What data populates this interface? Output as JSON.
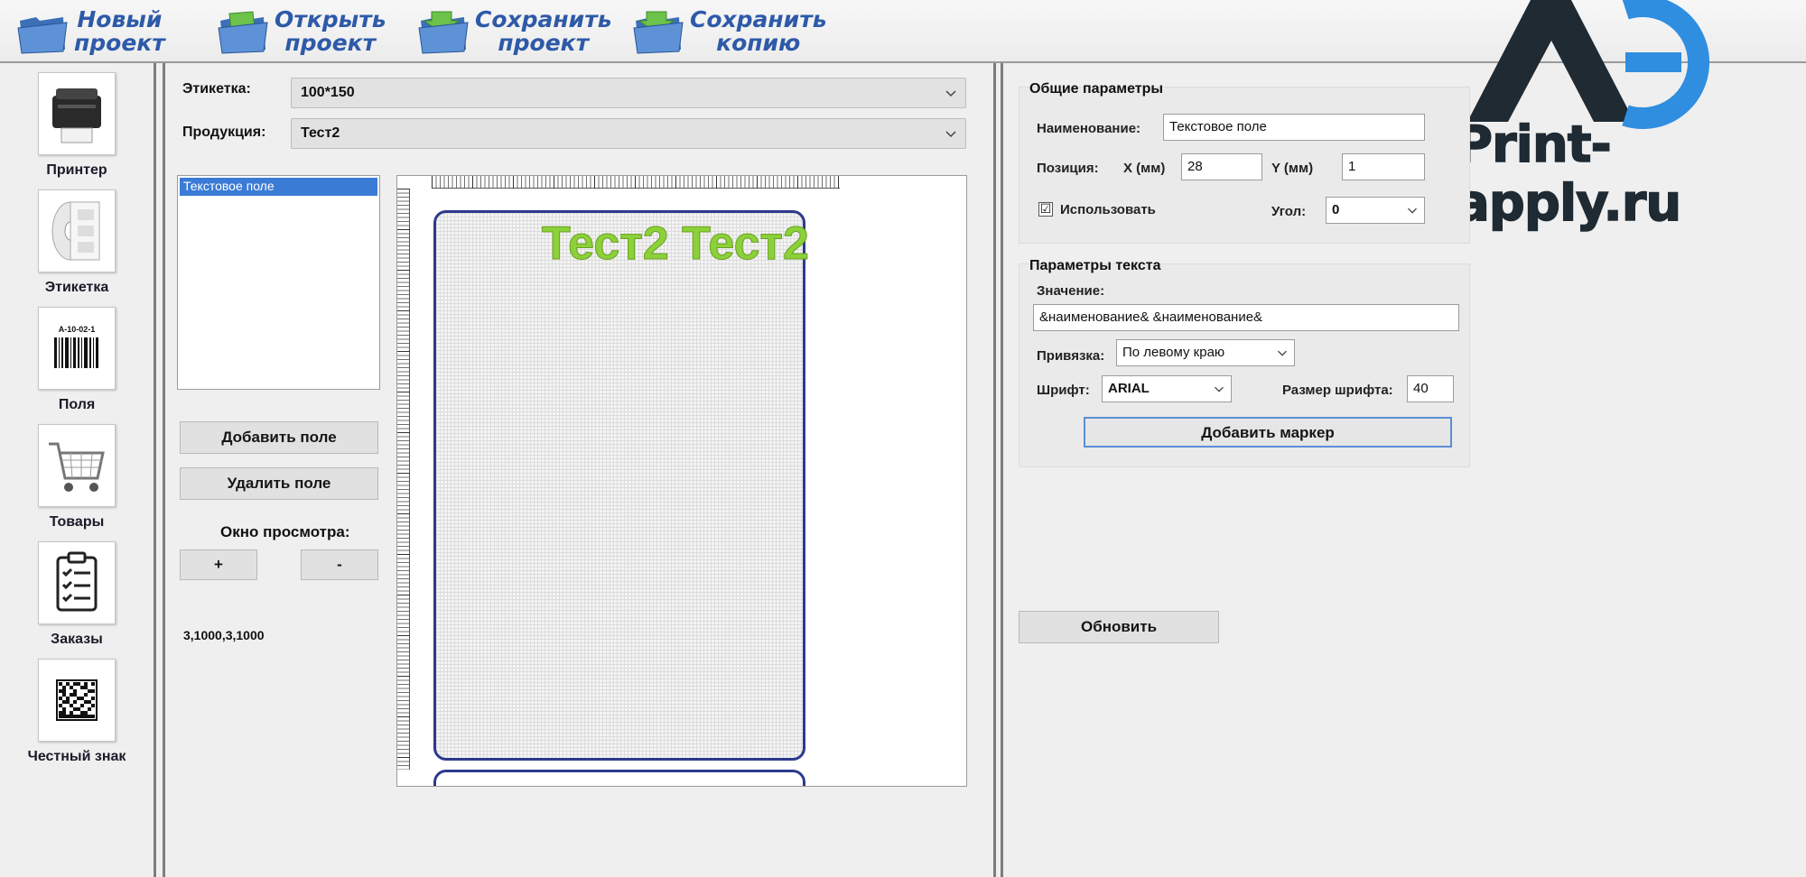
{
  "toolbar": {
    "new_project": [
      "Новый",
      "проект"
    ],
    "open_project": [
      "Открыть",
      "проект"
    ],
    "save_project": [
      "Сохранить",
      "проект"
    ],
    "save_copy": [
      "Сохранить",
      "копию"
    ]
  },
  "logo": {
    "text": "Print-apply.ru"
  },
  "nav": {
    "printer": "Принтер",
    "label": "Этикетка",
    "fields": "Поля",
    "goods": "Товары",
    "orders": "Заказы",
    "honest_sign": "Честный знак",
    "barcode_caption": "A-10-02-1"
  },
  "middle": {
    "label_caption": "Этикетка:",
    "label_value": "100*150",
    "product_caption": "Продукция:",
    "product_value": "Тест2",
    "fields_list": [
      "Текстовое поле"
    ],
    "add_field": "Добавить поле",
    "remove_field": "Удалить поле",
    "preview_title": "Окно просмотра:",
    "zoom_in": "+",
    "zoom_out": "-",
    "coords": "3,1000,3,1000",
    "canvas_text": "Тест2 Тест2"
  },
  "general": {
    "title": "Общие параметры",
    "name_label": "Наименование:",
    "name_value": "Текстовое поле",
    "position_label": "Позиция:",
    "x_label": "X (мм)",
    "x_value": "28",
    "y_label": "Y (мм)",
    "y_value": "1",
    "use_label": "Использовать",
    "use_checked": "☑",
    "angle_label": "Угол:",
    "angle_value": "0"
  },
  "text_params": {
    "title": "Параметры текста",
    "value_label": "Значение:",
    "value": "&наименование& &наименование&",
    "align_label": "Привязка:",
    "align_value": "По левому краю",
    "font_label": "Шрифт:",
    "font_value": "ARIAL",
    "size_label": "Размер шрифта:",
    "size_value": "40",
    "add_marker": "Добавить маркер"
  },
  "refresh": "Обновить",
  "colors": {
    "toolbar_text": "#2e5aa8",
    "canvas_text": "#8cd13a",
    "label_border": "#2d3a8c",
    "logo_blue": "#2f8ee0"
  }
}
